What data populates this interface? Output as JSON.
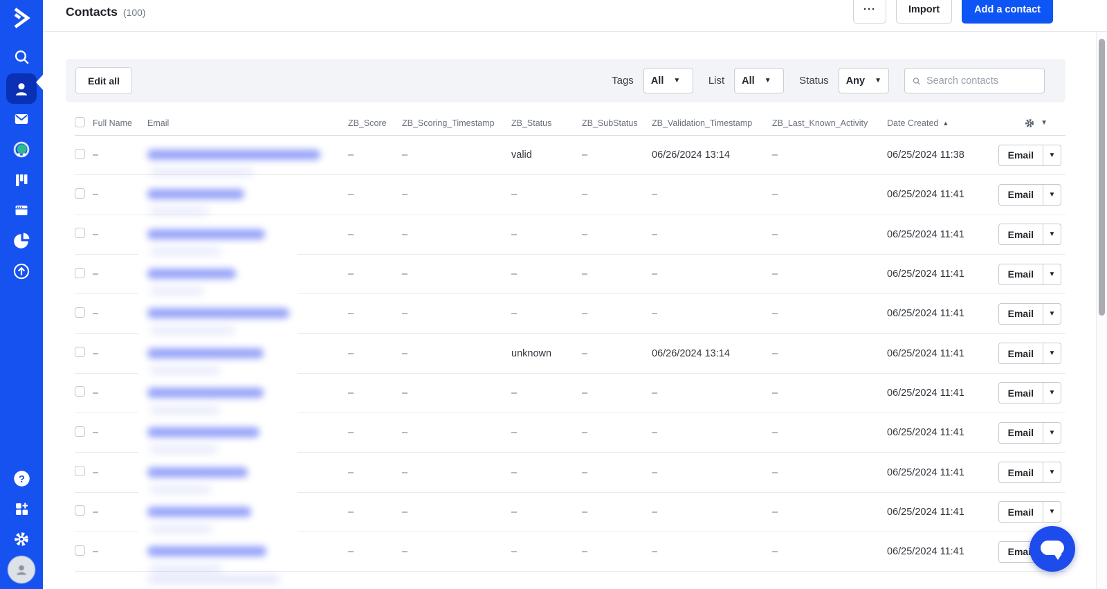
{
  "header": {
    "title": "Contacts",
    "count": "(100)",
    "more_label": "···",
    "import_label": "Import",
    "add_contact_label": "Add a contact"
  },
  "sidebar": {
    "icons": [
      "logo",
      "search",
      "contacts",
      "campaigns",
      "conversations",
      "deals",
      "website",
      "reports",
      "upgrade",
      "help",
      "apps",
      "settings",
      "account"
    ],
    "active": "contacts"
  },
  "filters": {
    "edit_all_label": "Edit all",
    "tags_label": "Tags",
    "tags_value": "All",
    "list_label": "List",
    "list_value": "All",
    "status_label": "Status",
    "status_value": "Any",
    "search_placeholder": "Search contacts"
  },
  "table": {
    "columns": [
      "Full Name",
      "Email",
      "ZB_Score",
      "ZB_Scoring_Timestamp",
      "ZB_Status",
      "ZB_SubStatus",
      "ZB_Validation_Timestamp",
      "ZB_Last_Known_Activity",
      "Date Created"
    ],
    "sort_column": "Date Created",
    "sort_direction": "asc",
    "sort_arrow": "▲",
    "action_label": "Email",
    "empty_value": "–",
    "rows": [
      {
        "full_name": "–",
        "email_redacted": true,
        "email_blur_width": 250,
        "zb_score": "–",
        "zb_scoring_timestamp": "–",
        "zb_status": "valid",
        "zb_substatus": "–",
        "zb_validation_timestamp": "06/26/2024 13:14",
        "zb_last_known_activity": "–",
        "date_created": "06/25/2024 11:38"
      },
      {
        "full_name": "–",
        "email_redacted": true,
        "email_blur_width": 140,
        "zb_score": "–",
        "zb_scoring_timestamp": "–",
        "zb_status": "–",
        "zb_substatus": "–",
        "zb_validation_timestamp": "–",
        "zb_last_known_activity": "–",
        "date_created": "06/25/2024 11:41"
      },
      {
        "full_name": "–",
        "email_redacted": true,
        "email_blur_width": 170,
        "zb_score": "–",
        "zb_scoring_timestamp": "–",
        "zb_status": "–",
        "zb_substatus": "–",
        "zb_validation_timestamp": "–",
        "zb_last_known_activity": "–",
        "date_created": "06/25/2024 11:41"
      },
      {
        "full_name": "–",
        "email_redacted": true,
        "email_blur_width": 128,
        "zb_score": "–",
        "zb_scoring_timestamp": "–",
        "zb_status": "–",
        "zb_substatus": "–",
        "zb_validation_timestamp": "–",
        "zb_last_known_activity": "–",
        "date_created": "06/25/2024 11:41"
      },
      {
        "full_name": "–",
        "email_redacted": true,
        "email_blur_width": 205,
        "zb_score": "–",
        "zb_scoring_timestamp": "–",
        "zb_status": "–",
        "zb_substatus": "–",
        "zb_validation_timestamp": "–",
        "zb_last_known_activity": "–",
        "date_created": "06/25/2024 11:41"
      },
      {
        "full_name": "–",
        "email_redacted": true,
        "email_blur_width": 168,
        "zb_score": "–",
        "zb_scoring_timestamp": "–",
        "zb_status": "unknown",
        "zb_substatus": "–",
        "zb_validation_timestamp": "06/26/2024 13:14",
        "zb_last_known_activity": "–",
        "date_created": "06/25/2024 11:41"
      },
      {
        "full_name": "–",
        "email_redacted": true,
        "email_blur_width": 168,
        "zb_score": "–",
        "zb_scoring_timestamp": "–",
        "zb_status": "–",
        "zb_substatus": "–",
        "zb_validation_timestamp": "–",
        "zb_last_known_activity": "–",
        "date_created": "06/25/2024 11:41"
      },
      {
        "full_name": "–",
        "email_redacted": true,
        "email_blur_width": 162,
        "zb_score": "–",
        "zb_scoring_timestamp": "–",
        "zb_status": "–",
        "zb_substatus": "–",
        "zb_validation_timestamp": "–",
        "zb_last_known_activity": "–",
        "date_created": "06/25/2024 11:41"
      },
      {
        "full_name": "–",
        "email_redacted": true,
        "email_blur_width": 145,
        "zb_score": "–",
        "zb_scoring_timestamp": "–",
        "zb_status": "–",
        "zb_substatus": "–",
        "zb_validation_timestamp": "–",
        "zb_last_known_activity": "–",
        "date_created": "06/25/2024 11:41"
      },
      {
        "full_name": "–",
        "email_redacted": true,
        "email_blur_width": 150,
        "zb_score": "–",
        "zb_scoring_timestamp": "–",
        "zb_status": "–",
        "zb_substatus": "–",
        "zb_validation_timestamp": "–",
        "zb_last_known_activity": "–",
        "date_created": "06/25/2024 11:41"
      },
      {
        "full_name": "–",
        "email_redacted": true,
        "email_blur_width": 172,
        "zb_score": "–",
        "zb_scoring_timestamp": "–",
        "zb_status": "–",
        "zb_substatus": "–",
        "zb_validation_timestamp": "–",
        "zb_last_known_activity": "–",
        "date_created": "06/25/2024 11:41"
      }
    ]
  },
  "colors": {
    "sidebar": "#1652F0",
    "active_nav": "#0A31B5",
    "primary_button": "#0D55F4",
    "redacted_link": "#5A6EF5",
    "conversations_dot": "#2FB98E"
  }
}
